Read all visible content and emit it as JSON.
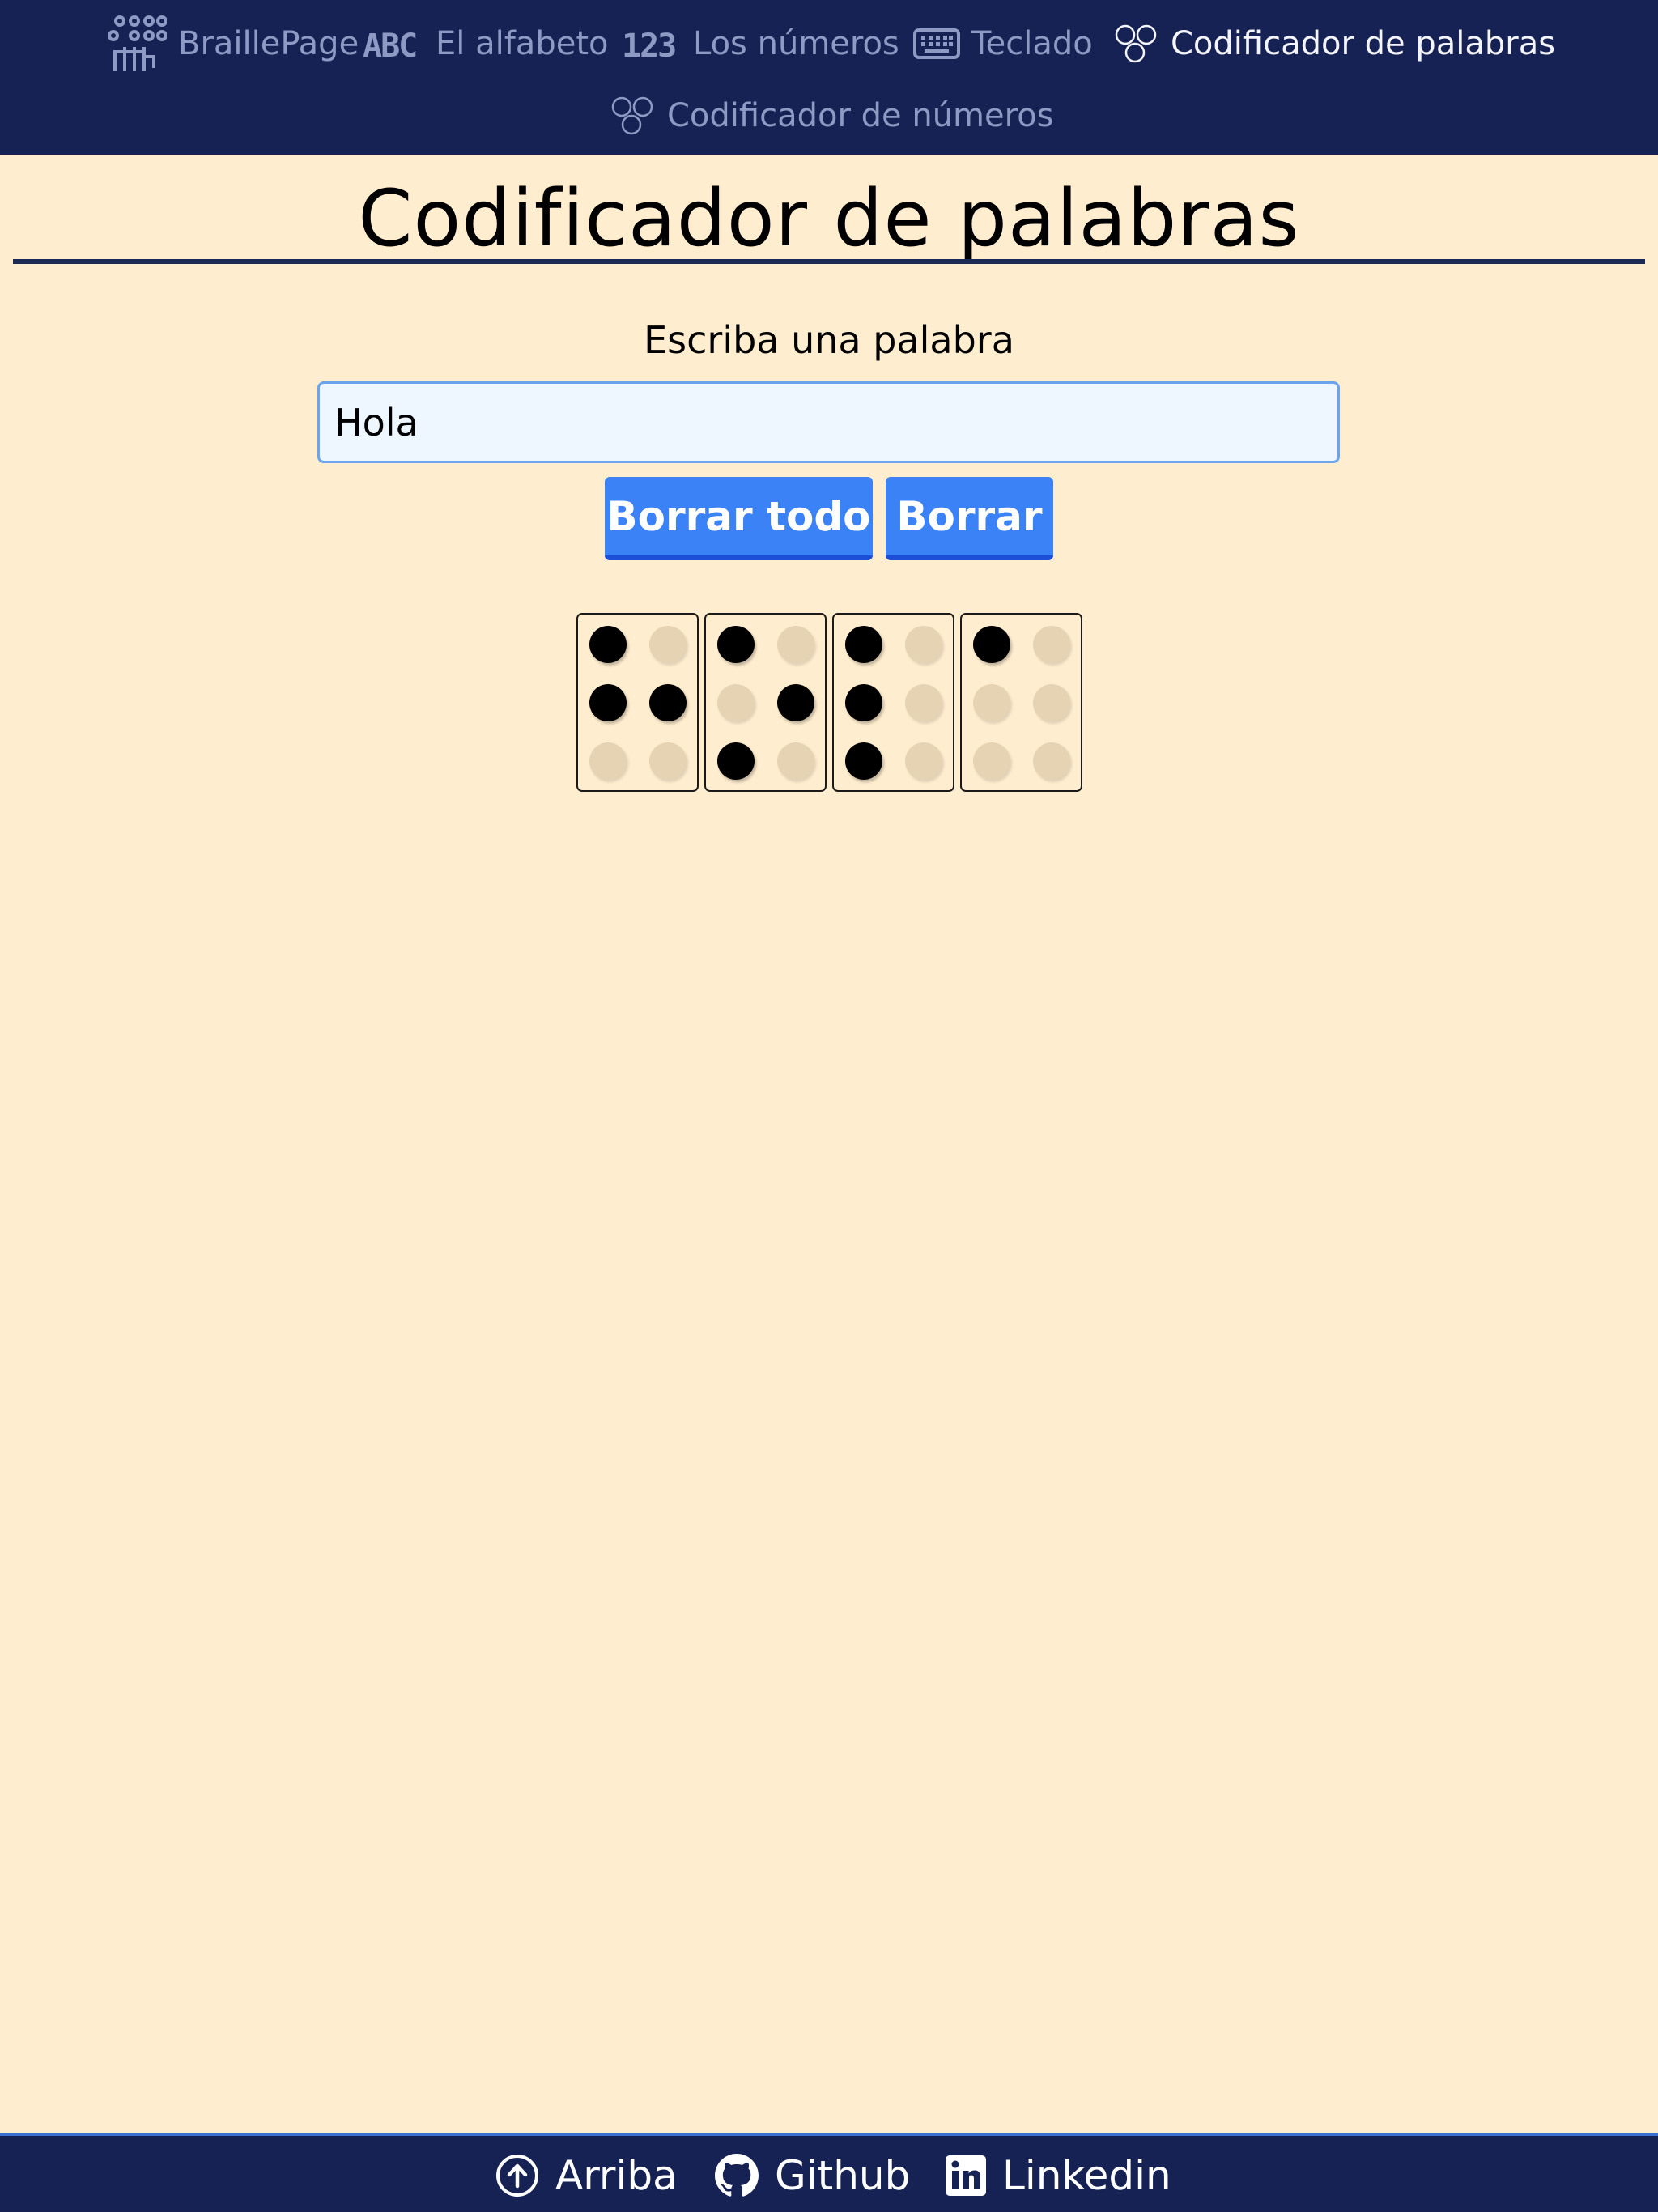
{
  "nav": {
    "items": [
      {
        "label": "BraillePage",
        "icon": "braille-hand-icon"
      },
      {
        "label": "El alfabeto",
        "icon": "abc-icon"
      },
      {
        "label": "Los números",
        "icon": "numbers-123-icon"
      },
      {
        "label": "Teclado",
        "icon": "keyboard-icon"
      },
      {
        "label": "Codificador de palabras",
        "icon": "braille-dots-icon",
        "active": true
      },
      {
        "label": "Codificador de números",
        "icon": "braille-dots-icon"
      }
    ],
    "colors": {
      "background": "#162253",
      "text": "#8e9ac4",
      "active_text": "#f4f5fb"
    }
  },
  "main": {
    "title": "Codificador de palabras",
    "prompt": "Escriba una palabra",
    "input": {
      "value": "Hola"
    },
    "buttons": {
      "clear_all": "Borrar todo",
      "clear": "Borrar"
    },
    "braille_cells": [
      {
        "letter": "H",
        "dots": [
          1,
          2,
          5
        ]
      },
      {
        "letter": "o",
        "dots": [
          1,
          3,
          5
        ]
      },
      {
        "letter": "l",
        "dots": [
          1,
          2,
          3
        ]
      },
      {
        "letter": "a",
        "dots": [
          1
        ]
      }
    ]
  },
  "footer": {
    "links": [
      {
        "label": "Arriba",
        "icon": "arrow-up-circle-icon"
      },
      {
        "label": "Github",
        "icon": "github-icon"
      },
      {
        "label": "Linkedin",
        "icon": "linkedin-icon"
      }
    ]
  },
  "colors": {
    "page_background": "#ffedcf",
    "button": "#3b82f6",
    "input_background": "#eef6ff"
  }
}
